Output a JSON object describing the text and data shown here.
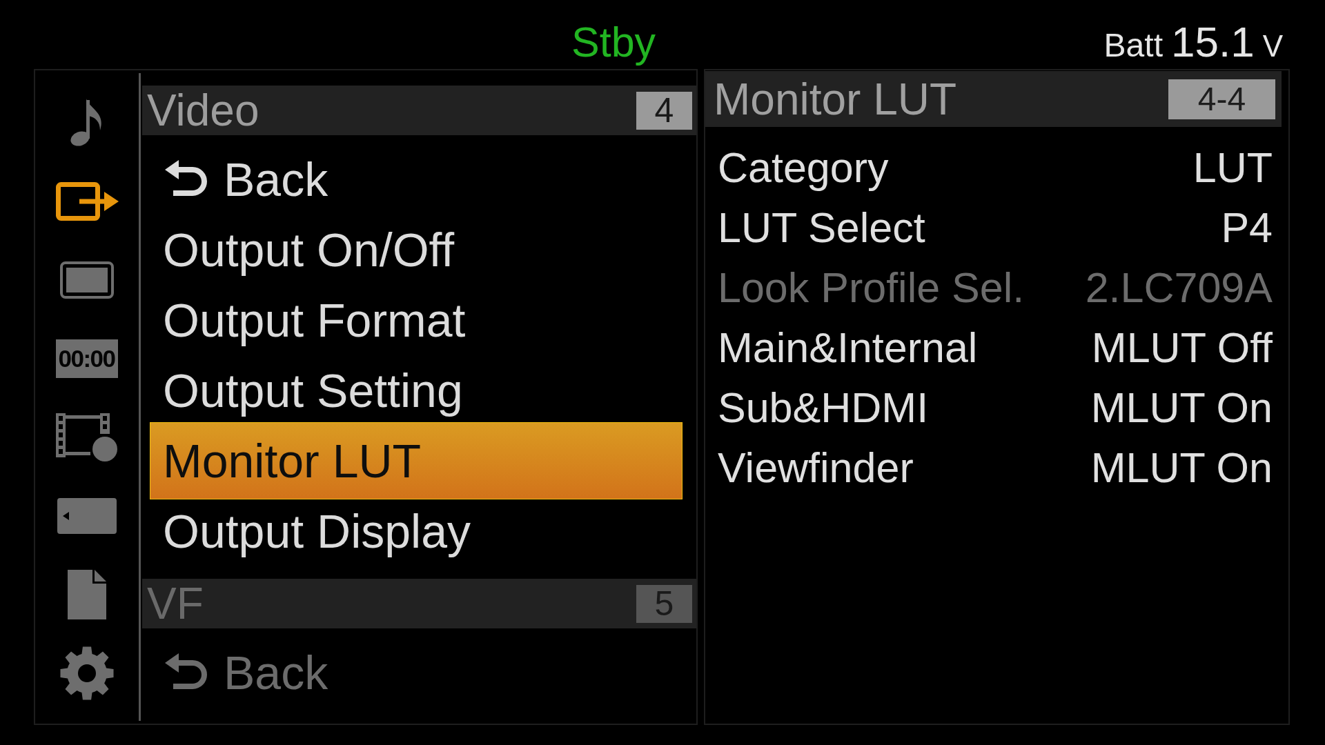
{
  "status": {
    "text": "Stby"
  },
  "battery": {
    "label": "Batt",
    "value": "15.1",
    "unit": "V"
  },
  "sidebar": {
    "tabs": [
      {
        "kind": "audio",
        "selected": false
      },
      {
        "kind": "output",
        "selected": true
      },
      {
        "kind": "monitor",
        "selected": false
      },
      {
        "kind": "timecode",
        "label": "00:00",
        "selected": false
      },
      {
        "kind": "film",
        "selected": false
      },
      {
        "kind": "media",
        "selected": false
      },
      {
        "kind": "file",
        "selected": false
      },
      {
        "kind": "settings",
        "selected": false
      }
    ]
  },
  "menu": {
    "sections": [
      {
        "title": "Video",
        "number": "4",
        "active": true,
        "items": [
          {
            "kind": "back",
            "label": "Back",
            "selected": false
          },
          {
            "kind": "item",
            "label": "Output On/Off",
            "selected": false
          },
          {
            "kind": "item",
            "label": "Output Format",
            "selected": false
          },
          {
            "kind": "item",
            "label": "Output Setting",
            "selected": false
          },
          {
            "kind": "item",
            "label": "Monitor LUT",
            "selected": true
          },
          {
            "kind": "item",
            "label": "Output Display",
            "selected": false
          }
        ]
      },
      {
        "title": "VF",
        "number": "5",
        "active": false,
        "items": [
          {
            "kind": "back",
            "label": "Back",
            "selected": false
          }
        ]
      }
    ]
  },
  "detail": {
    "title": "Monitor LUT",
    "number": "4-4",
    "rows": [
      {
        "label": "Category",
        "value": "LUT",
        "disabled": false
      },
      {
        "label": "LUT Select",
        "value": "P4",
        "disabled": false
      },
      {
        "label": "Look Profile Sel.",
        "value": "2.LC709A",
        "disabled": true
      },
      {
        "label": "Main&Internal",
        "value": "MLUT Off",
        "disabled": false
      },
      {
        "label": "Sub&HDMI",
        "value": "MLUT On",
        "disabled": false
      },
      {
        "label": "Viewfinder",
        "value": "MLUT On",
        "disabled": false
      }
    ]
  }
}
